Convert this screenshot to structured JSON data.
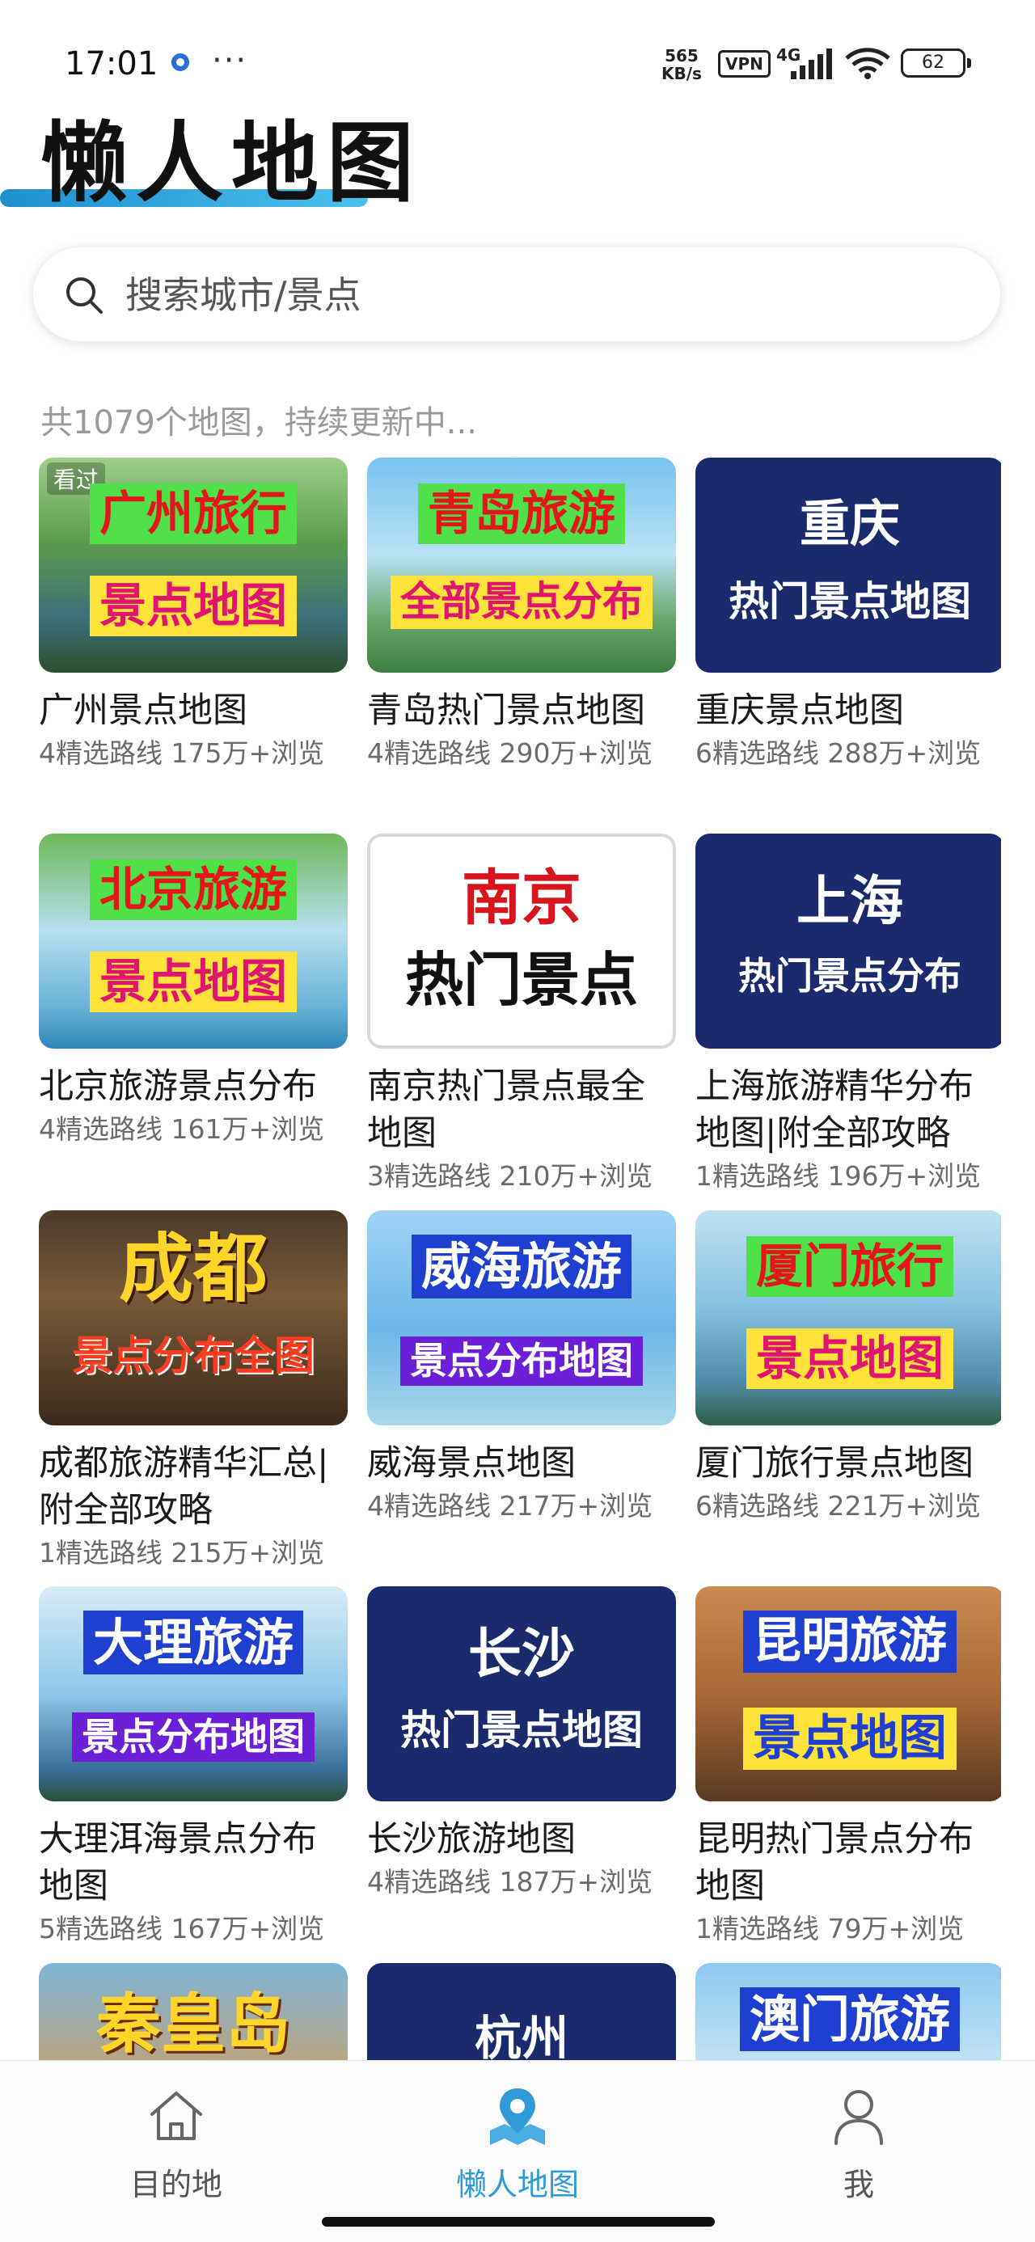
{
  "status_bar": {
    "time": "17:01",
    "more": "···",
    "net_speed_value": "565",
    "net_speed_unit": "KB/s",
    "vpn": "VPN",
    "network": "4G",
    "battery": "62"
  },
  "header": {
    "title": "懒人地图"
  },
  "search": {
    "placeholder": "搜索城市/景点"
  },
  "map_count": "共1079个地图，持续更新中...",
  "maps": [
    {
      "title": "广州景点地图",
      "meta": "4精选路线 175万+浏览",
      "thumb_line1": "广州旅行",
      "thumb_line2": "景点地图",
      "seen": "看过"
    },
    {
      "title": "青岛热门景点地图",
      "meta": "4精选路线 290万+浏览",
      "thumb_line1": "青岛旅游",
      "thumb_line2": "全部景点分布"
    },
    {
      "title": "重庆景点地图",
      "meta": "6精选路线 288万+浏览",
      "thumb_line1": "重庆",
      "thumb_line2": "热门景点地图"
    },
    {
      "title": "北京旅游景点分布",
      "meta": "4精选路线 161万+浏览",
      "thumb_line1": "北京旅游",
      "thumb_line2": "景点地图"
    },
    {
      "title": "南京热门景点最全地图",
      "meta": "3精选路线 210万+浏览",
      "thumb_line1": "南京",
      "thumb_line2": "热门景点"
    },
    {
      "title": "上海旅游精华分布地图|附全部攻略",
      "meta": "1精选路线 196万+浏览",
      "thumb_line1": "上海",
      "thumb_line2": "热门景点分布"
    },
    {
      "title": "成都旅游精华汇总|附全部攻略",
      "meta": "1精选路线 215万+浏览",
      "thumb_line1": "成都",
      "thumb_line2": "景点分布全图"
    },
    {
      "title": "威海景点地图",
      "meta": "4精选路线 217万+浏览",
      "thumb_line1": "威海旅游",
      "thumb_line2": "景点分布地图"
    },
    {
      "title": "厦门旅行景点地图",
      "meta": "6精选路线 221万+浏览",
      "thumb_line1": "厦门旅行",
      "thumb_line2": "景点地图"
    },
    {
      "title": "大理洱海景点分布地图",
      "meta": "5精选路线 167万+浏览",
      "thumb_line1": "大理旅游",
      "thumb_line2": "景点分布地图"
    },
    {
      "title": "长沙旅游地图",
      "meta": "4精选路线 187万+浏览",
      "thumb_line1": "长沙",
      "thumb_line2": "热门景点地图"
    },
    {
      "title": "昆明热门景点分布地图",
      "meta": "1精选路线 79万+浏览",
      "thumb_line1": "昆明旅游",
      "thumb_line2": "景点地图"
    },
    {
      "thumb_line1": "秦皇岛"
    },
    {
      "thumb_line1": "杭州"
    },
    {
      "thumb_line1": "澳门旅游"
    }
  ],
  "bottom_nav": [
    {
      "label": "目的地",
      "icon": "home-icon",
      "active": false
    },
    {
      "label": "懒人地图",
      "icon": "map-pin-icon",
      "active": true
    },
    {
      "label": "我",
      "icon": "user-icon",
      "active": false
    }
  ],
  "colors": {
    "accent": "#2e9ad8",
    "card_navy": "#1a2a6c"
  }
}
